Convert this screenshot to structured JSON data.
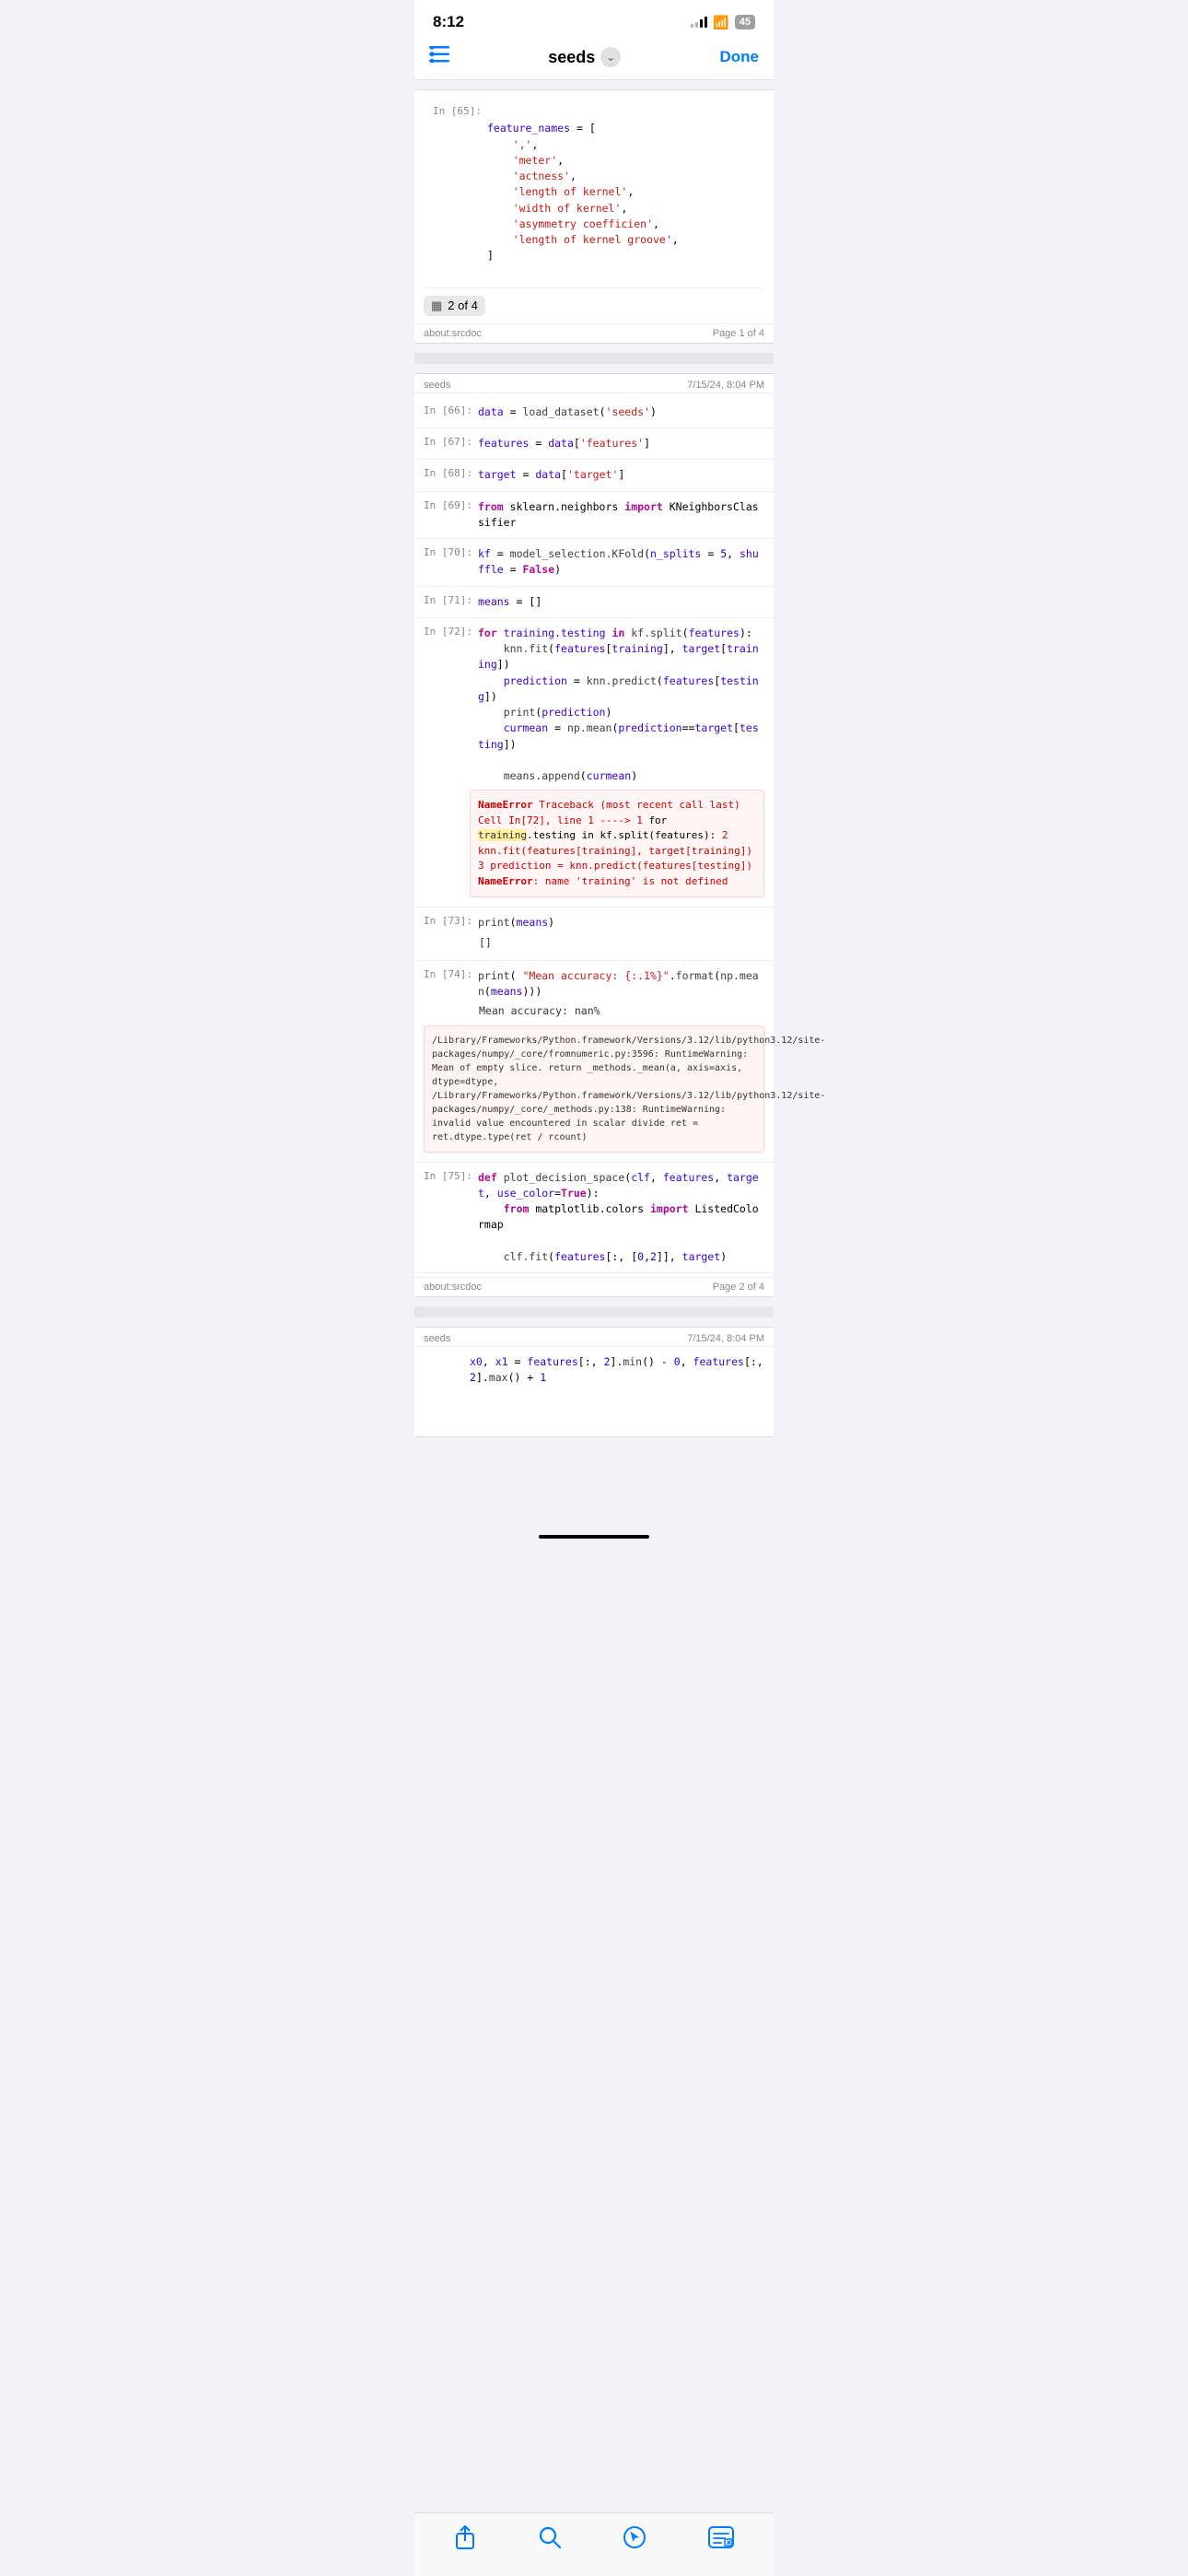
{
  "statusBar": {
    "time": "8:12",
    "battery": "45"
  },
  "navBar": {
    "title": "seeds",
    "doneLabel": "Done"
  },
  "page1": {
    "headerLabel": "",
    "footerLeft": "about:srcdoc",
    "footerRight": "Page 1 of 4",
    "paginationText": "2 of 4",
    "cells": [
      {
        "label": "In [65]:",
        "code": "feature_names = [\n    ',\n    'meter',\n    'actness',\n    'length of kernel',\n    'width of kernel',\n    'asymmetry coefficien',\n    'length of kernel groove',\n]"
      }
    ]
  },
  "page2": {
    "headerLeft": "seeds",
    "headerRight": "7/15/24, 8:04 PM",
    "footerLeft": "about:srcdoc",
    "footerRight": "Page 2 of 4",
    "cells": [
      {
        "id": "66",
        "code": "data = load_dataset('seeds')"
      },
      {
        "id": "67",
        "code": "features = data['features']"
      },
      {
        "id": "68",
        "code": "target = data['target']"
      },
      {
        "id": "69",
        "code": "from sklearn.neighbors import KNeighborsClassifier"
      },
      {
        "id": "70",
        "code": "kf = model_selection.KFold(n_splits = 5, shuffle = False)"
      },
      {
        "id": "71",
        "code": "means = []"
      },
      {
        "id": "72",
        "code": "for training.testing in kf.split(features):\n    knn.fit(features[training], target[training])\n    prediction = knn.predict(features[testing])\n    print(prediction)\n    curmean = np.mean(prediction==target[testing])\n\n    means.append(curmean)"
      },
      {
        "id": "73",
        "code": "print(means)"
      },
      {
        "id": "74",
        "code": "print( \"Mean accuracy: {:.1%}\".format(np.mean(means)))"
      },
      {
        "id": "75",
        "code": "def plot_decision_space(clf, features, target, use_color=True):\n    from matplotlib.colors import ListedColormap\n\n    clf.fit(features[:, [0,2]], target)"
      }
    ],
    "outputs": {
      "73": "[]",
      "74_text": "Mean accuracy: nan%",
      "74_warning": "/Library/Frameworks/Python.framework/Versions/3.12/lib/python3.12/site-packages/numpy/_core/fromnumeric.py:3596: RuntimeWarning: Mean of empty slice.\n  return _methods._mean(a, axis=axis, dtype=dtype,\n/Library/Frameworks/Python.framework/Versions/3.12/lib/python3.12/site-packages/numpy/_core/_methods.py:138: RuntimeWarning: invalid value encountered in scalar divide\n  ret = ret.dtype.type(ret / rcount)"
    },
    "error72": {
      "type": "NameError",
      "traceback": "Traceback (most recent call last)",
      "cell": "Cell In[72], line 1",
      "arrow": "----> 1 for training.testing in kf.split(features):",
      "highlight": "training",
      "line2": "      2      knn.fit(features[training], target[training])",
      "line3": "      3      prediction = knn.predict(features[testing])",
      "message": "NameError: name 'training' is not defined"
    }
  },
  "page3": {
    "headerLeft": "seeds",
    "headerRight": "7/15/24, 8:04 PM",
    "previewCode": "x0, x1 = features[:, 2].min() - 0, features[:, 2].max() + 1"
  },
  "toolbar": {
    "shareLabel": "share",
    "searchLabel": "search",
    "navigateLabel": "navigate",
    "editLabel": "edit"
  }
}
